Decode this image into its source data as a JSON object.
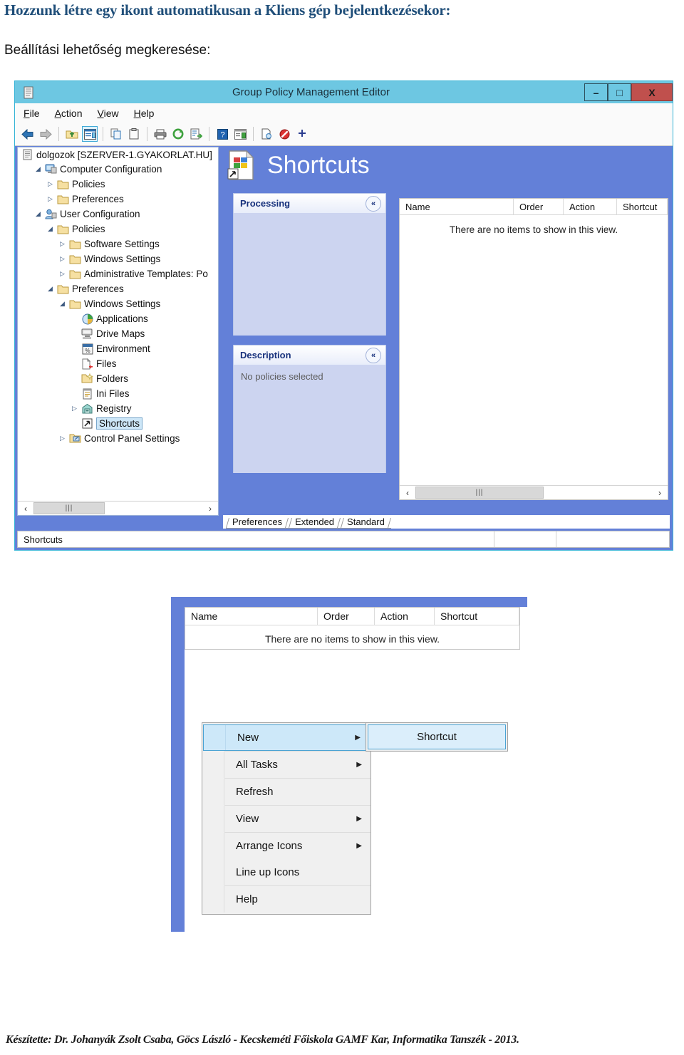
{
  "document": {
    "heading": "Hozzunk létre egy ikont automatikusan a Kliens gép bejelentkezésekor:",
    "subheading": "Beállítási lehetőség megkeresése:",
    "footer": "Készítette: Dr. Johanyák Zsolt Csaba, Göcs László - Kecskeméti Főiskola GAMF Kar, Informatika Tanszék - 2013."
  },
  "colors": {
    "heading": "#1f4e79",
    "titlebar": "#6dc7e2",
    "close_button": "#c0504d",
    "pane_blue": "#6380d8",
    "panel_body": "#ccd4f0",
    "selection": "#cde6f7",
    "menu_highlight": "#cde8f9"
  },
  "window": {
    "title": "Group Policy Management Editor",
    "icon": "console-icon",
    "controls": [
      {
        "name": "minimize-button",
        "glyph": "–"
      },
      {
        "name": "maximize-button",
        "glyph": "□"
      },
      {
        "name": "close-button",
        "glyph": "X"
      }
    ],
    "menubar": [
      {
        "accel": "F",
        "rest": "ile"
      },
      {
        "accel": "A",
        "rest": "ction"
      },
      {
        "accel": "V",
        "rest": "iew"
      },
      {
        "accel": "H",
        "rest": "elp"
      }
    ],
    "toolbar": [
      "back-arrow-icon",
      "forward-arrow-icon",
      "separator",
      "up-folder-icon",
      "properties-icon",
      "separator",
      "copy-icon",
      "paste-icon",
      "separator",
      "print-icon",
      "refresh-icon",
      "export-list-icon",
      "separator",
      "help-icon",
      "show-hide-console-tree-icon",
      "separator",
      "new-document-icon",
      "disable-icon",
      "add-icon"
    ]
  },
  "tree": {
    "root": {
      "label": "dolgozok [SZERVER-1.GYAKORLAT.HU]",
      "icon": "gpo-icon"
    },
    "nodes": [
      {
        "label": "Computer Configuration",
        "icon": "computer-icon",
        "indent": 1,
        "twist": "◢",
        "selected": false
      },
      {
        "label": "Policies",
        "icon": "folder-icon",
        "indent": 2,
        "twist": "▷",
        "selected": false
      },
      {
        "label": "Preferences",
        "icon": "folder-icon",
        "indent": 2,
        "twist": "▷",
        "selected": false
      },
      {
        "label": "User Configuration",
        "icon": "user-icon",
        "indent": 1,
        "twist": "◢",
        "selected": false
      },
      {
        "label": "Policies",
        "icon": "folder-icon",
        "indent": 2,
        "twist": "◢",
        "selected": false
      },
      {
        "label": "Software Settings",
        "icon": "folder-icon",
        "indent": 3,
        "twist": "▷",
        "selected": false
      },
      {
        "label": "Windows Settings",
        "icon": "folder-icon",
        "indent": 3,
        "twist": "▷",
        "selected": false
      },
      {
        "label": "Administrative Templates: Po",
        "icon": "folder-icon",
        "indent": 3,
        "twist": "▷",
        "selected": false
      },
      {
        "label": "Preferences",
        "icon": "folder-icon",
        "indent": 2,
        "twist": "◢",
        "selected": false
      },
      {
        "label": "Windows Settings",
        "icon": "folder-icon",
        "indent": 3,
        "twist": "◢",
        "selected": false
      },
      {
        "label": "Applications",
        "icon": "applications-icon",
        "indent": 4,
        "twist": "",
        "selected": false
      },
      {
        "label": "Drive Maps",
        "icon": "drive-maps-icon",
        "indent": 4,
        "twist": "",
        "selected": false
      },
      {
        "label": "Environment",
        "icon": "environment-icon",
        "indent": 4,
        "twist": "",
        "selected": false
      },
      {
        "label": "Files",
        "icon": "files-icon",
        "indent": 4,
        "twist": "",
        "selected": false
      },
      {
        "label": "Folders",
        "icon": "folders-icon",
        "indent": 4,
        "twist": "",
        "selected": false
      },
      {
        "label": "Ini Files",
        "icon": "ini-files-icon",
        "indent": 4,
        "twist": "",
        "selected": false
      },
      {
        "label": "Registry",
        "icon": "registry-icon",
        "indent": 4,
        "twist": "▷",
        "selected": false
      },
      {
        "label": "Shortcuts",
        "icon": "shortcuts-icon",
        "indent": 4,
        "twist": "",
        "selected": true
      },
      {
        "label": "Control Panel Settings",
        "icon": "control-panel-icon",
        "indent": 3,
        "twist": "▷",
        "selected": false
      }
    ],
    "scroll": {
      "left_arrow": "‹",
      "right_arrow": "›",
      "grip": "‖‖"
    }
  },
  "details": {
    "title": "Shortcuts",
    "title_icon": "shortcuts-large-icon",
    "panels": [
      {
        "name": "processing-panel",
        "header": "Processing",
        "body": "",
        "chevron": "«"
      },
      {
        "name": "description-panel",
        "header": "Description",
        "body": "No policies selected",
        "chevron": "«"
      }
    ],
    "list": {
      "columns": [
        "Name",
        "Order",
        "Action",
        "Shortcut"
      ],
      "empty_message": "There are no items to show in this view.",
      "rows": []
    },
    "tabs": [
      "Preferences",
      "Extended",
      "Standard"
    ],
    "active_tab": "Preferences"
  },
  "statusbar": {
    "text": "Shortcuts"
  },
  "context_demo": {
    "list": {
      "columns": [
        "Name",
        "Order",
        "Action",
        "Shortcut"
      ],
      "empty_message": "There are no items to show in this view."
    },
    "menu": [
      {
        "label": "New",
        "submenu": true,
        "highlighted": true,
        "separator_after": true
      },
      {
        "label": "All Tasks",
        "submenu": true,
        "highlighted": false,
        "separator_after": true
      },
      {
        "label": "Refresh",
        "submenu": false,
        "highlighted": false,
        "separator_after": true
      },
      {
        "label": "View",
        "submenu": true,
        "highlighted": false,
        "separator_after": true
      },
      {
        "label": "Arrange Icons",
        "submenu": true,
        "highlighted": false,
        "separator_after": false
      },
      {
        "label": "Line up Icons",
        "submenu": false,
        "highlighted": false,
        "separator_after": true
      },
      {
        "label": "Help",
        "submenu": false,
        "highlighted": false,
        "separator_after": false
      }
    ],
    "submenu": {
      "label": "Shortcut",
      "highlighted": true
    },
    "arrow_glyph": "▶"
  }
}
